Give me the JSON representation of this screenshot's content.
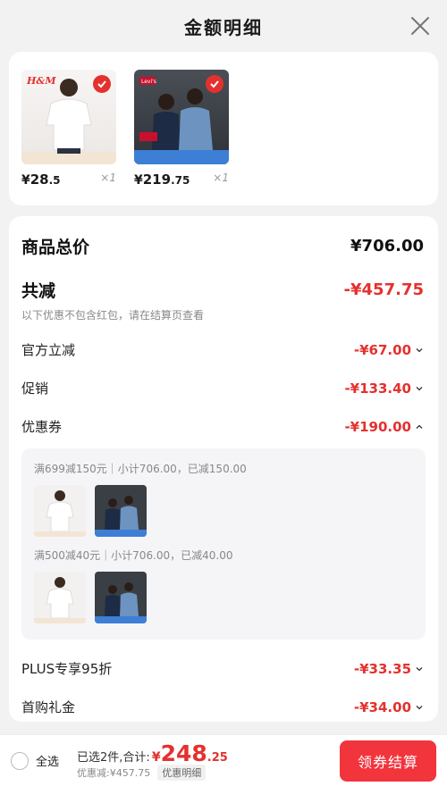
{
  "header": {
    "title": "金额明细",
    "close_icon": "close-icon"
  },
  "products": [
    {
      "price_int": "28",
      "price_dec": ".5",
      "qty": "×1",
      "brand": "H&M"
    },
    {
      "price_int": "219",
      "price_dec": ".75",
      "qty": "×1",
      "brand": "Levi's"
    }
  ],
  "currency": "¥",
  "summary": {
    "total_label": "商品总价",
    "total_value": "¥706.00",
    "discount_label": "共减",
    "discount_value": "-¥457.75",
    "discount_note": "以下优惠不包含红包，请在结算页查看",
    "items": [
      {
        "label": "官方立减",
        "value": "-¥67.00"
      },
      {
        "label": "促销",
        "value": "-¥133.40"
      },
      {
        "label": "优惠券",
        "value": "-¥190.00"
      }
    ],
    "coupons": [
      {
        "text": "满699减150元｜小计706.00，已减150.00"
      },
      {
        "text": "满500减40元｜小计706.00，已减40.00"
      }
    ],
    "items_after": [
      {
        "label": "PLUS专享95折",
        "value": "-¥33.35"
      },
      {
        "label": "首购礼金",
        "value": "-¥34.00"
      }
    ]
  },
  "bottom": {
    "select_all": "全选",
    "selected_prefix": "已选2件,合计:",
    "total_int": "248",
    "total_dec": ".25",
    "discount_text": "优惠减:¥457.75",
    "detail_label": "优惠明细",
    "checkout_label": "领券结算"
  },
  "colors": {
    "accent": "#e4312f",
    "button": "#f2343c",
    "background": "#f2f2f2"
  }
}
